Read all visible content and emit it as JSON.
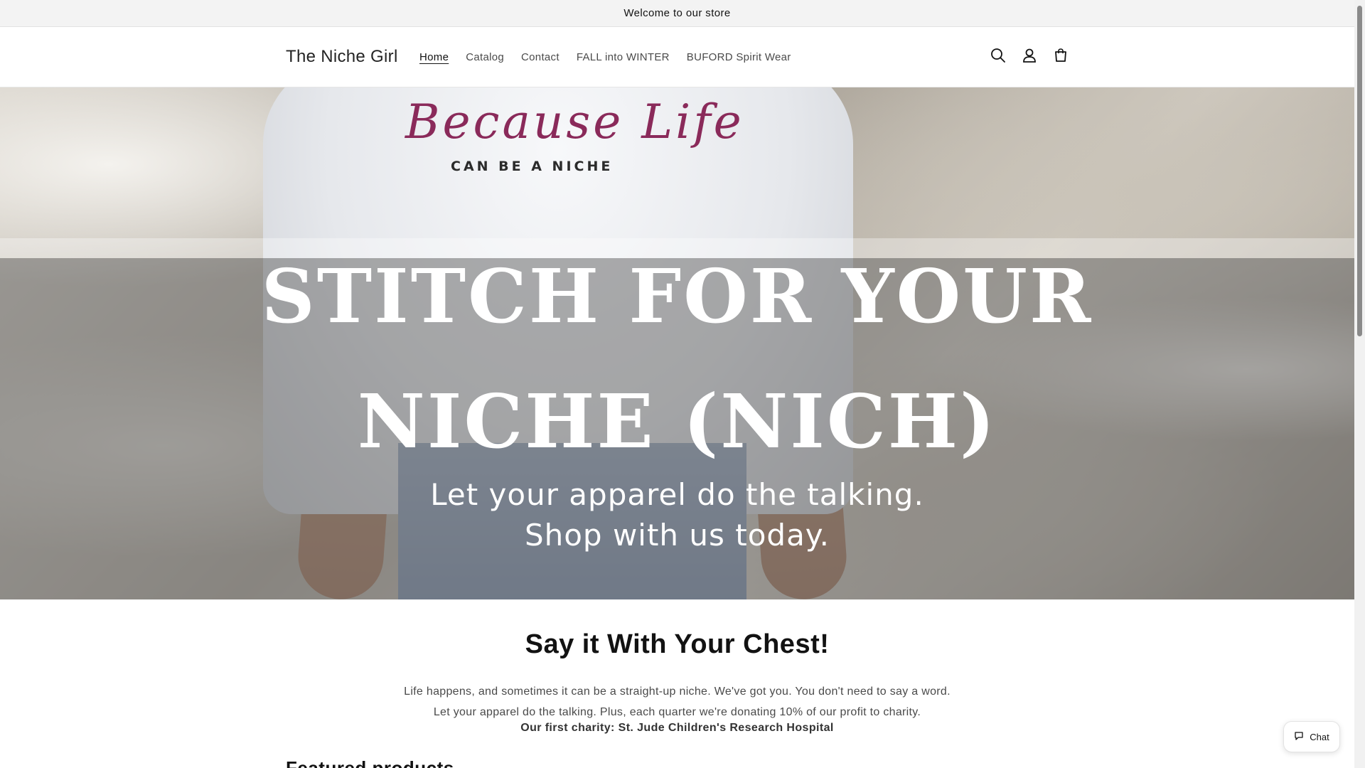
{
  "announcement": {
    "text": "Welcome to our store"
  },
  "header": {
    "logo": "The Niche Girl",
    "nav": [
      "Home",
      "Catalog",
      "Contact",
      "FALL into WINTER",
      "BUFORD Spirit Wear"
    ],
    "active_nav": "Home",
    "icons": [
      "search-icon",
      "account-icon",
      "cart-icon"
    ]
  },
  "hero": {
    "brand_script": "Because Life",
    "brand_sub": "CAN BE A NICHE",
    "headline_line1": "STITCH FOR YOUR",
    "headline_line2": "NICHE (NICH)",
    "sub_line1": "Let your apparel do the talking.",
    "sub_line2": "Shop with us today."
  },
  "intro": {
    "title": "Say it With Your Chest!",
    "text": "Life happens, and sometimes it can be a straight-up niche. We've got you. You don't need to say a word. Let your apparel do the talking. Plus, each quarter we're donating 10% of our profit to charity.",
    "bold": "Our first charity: St. Jude Children's Research Hospital"
  },
  "featured": {
    "title": "Featured products"
  },
  "chat": {
    "label": "Chat"
  },
  "colors": {
    "accent": "#121212",
    "announcement_bg": "#f3f3f3",
    "text_muted": "#4a4a4a"
  }
}
